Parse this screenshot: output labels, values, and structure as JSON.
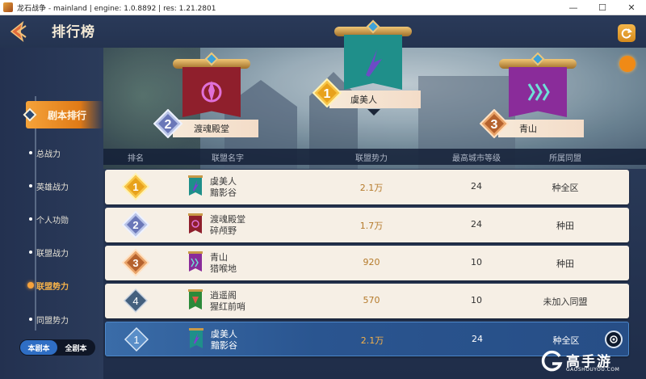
{
  "window": {
    "title": "龙石战争 - mainland | engine: 1.0.8892 | res: 1.21.2801",
    "minimize_glyph": "—",
    "maximize_glyph": "☐",
    "close_glyph": "✕"
  },
  "header": {
    "title": "排行榜",
    "back_icon": "back-arrow-icon",
    "refresh_icon": "refresh-icon"
  },
  "sidebar": {
    "main_item": "剧本排行",
    "items": [
      "总战力",
      "英雄战力",
      "个人功勋",
      "联盟战力",
      "联盟势力",
      "同盟势力"
    ],
    "active_index": 4,
    "toggle": [
      "本剧本",
      "全剧本"
    ],
    "toggle_selected": 0
  },
  "podium": [
    {
      "rank": "1",
      "name": "虞美人",
      "banner_color": "#1f8f8a",
      "emblem_color": "#7b3fd0"
    },
    {
      "rank": "2",
      "name": "渡魂殿堂",
      "banner_color": "#8f1f2c",
      "emblem_color": "#e070d8"
    },
    {
      "rank": "3",
      "name": "青山",
      "banner_color": "#8a2c9a",
      "emblem_color": "#6fdfd6"
    }
  ],
  "table": {
    "headers": [
      "排名",
      "联盟名字",
      "联盟势力",
      "最高城市等级",
      "所属同盟"
    ],
    "rows": [
      {
        "rank": "1",
        "name": "虞美人",
        "sub": "黯影谷",
        "power": "2.1万",
        "level": "24",
        "alliance": "种全区",
        "flag_color": "#1f8f8a",
        "medal": "gold"
      },
      {
        "rank": "2",
        "name": "渡魂殿堂",
        "sub": "碎颅野",
        "power": "1.7万",
        "level": "24",
        "alliance": "种田",
        "flag_color": "#8f1f2c",
        "medal": "silver"
      },
      {
        "rank": "3",
        "name": "青山",
        "sub": "猎喉地",
        "power": "920",
        "level": "10",
        "alliance": "种田",
        "flag_color": "#8a2c9a",
        "medal": "bronze"
      },
      {
        "rank": "4",
        "name": "逍遥阁",
        "sub": "猩红前哨",
        "power": "570",
        "level": "10",
        "alliance": "未加入同盟",
        "flag_color": "#2c8a3a",
        "medal": "plain"
      }
    ],
    "my_row": {
      "rank": "1",
      "name": "虞美人",
      "sub": "黯影谷",
      "power": "2.1万",
      "level": "24",
      "alliance": "种全区",
      "flag_color": "#1f8f8a"
    }
  },
  "watermark": {
    "brand": "高手游",
    "domain": "GAOSHOUYOU.COM"
  },
  "colors": {
    "accent": "#f29b2c",
    "highlight_row": "#2a5590",
    "power_text": "#b57a2a"
  }
}
